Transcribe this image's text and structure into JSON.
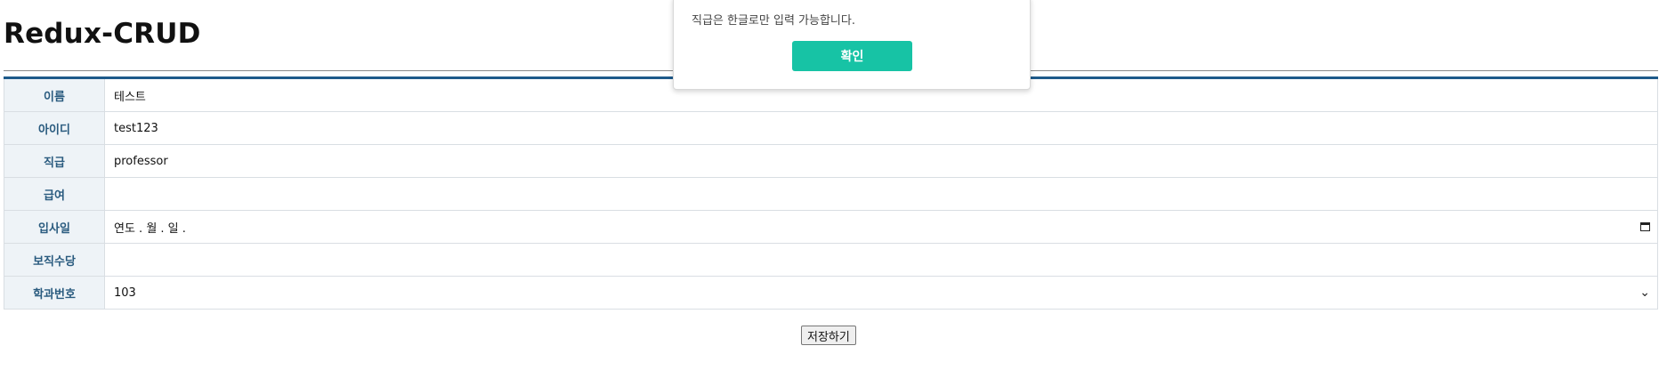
{
  "app": {
    "title": "Redux-CRUD"
  },
  "form": {
    "rows": [
      {
        "label": "이름",
        "value": "테스트",
        "type": "text"
      },
      {
        "label": "아이디",
        "value": "test123",
        "type": "text"
      },
      {
        "label": "직급",
        "value": "professor",
        "type": "text"
      },
      {
        "label": "급여",
        "value": "",
        "type": "text"
      },
      {
        "label": "입사일",
        "value": "연도 .  월 .  일 .",
        "type": "date"
      },
      {
        "label": "보직수당",
        "value": "",
        "type": "text"
      },
      {
        "label": "학과번호",
        "value": "103",
        "type": "select"
      }
    ],
    "icons": {
      "date": "calendar-icon",
      "select": "chevron-down-icon"
    },
    "save_label": "저장하기"
  },
  "alert": {
    "message": "직급은 한글로만 입력 가능합니다.",
    "ok_label": "확인",
    "ok_color": "#17c3a5"
  },
  "colors": {
    "header_border": "#1e5a8a",
    "label_text": "#2a5b7f",
    "label_bg": "#eef3f7"
  }
}
